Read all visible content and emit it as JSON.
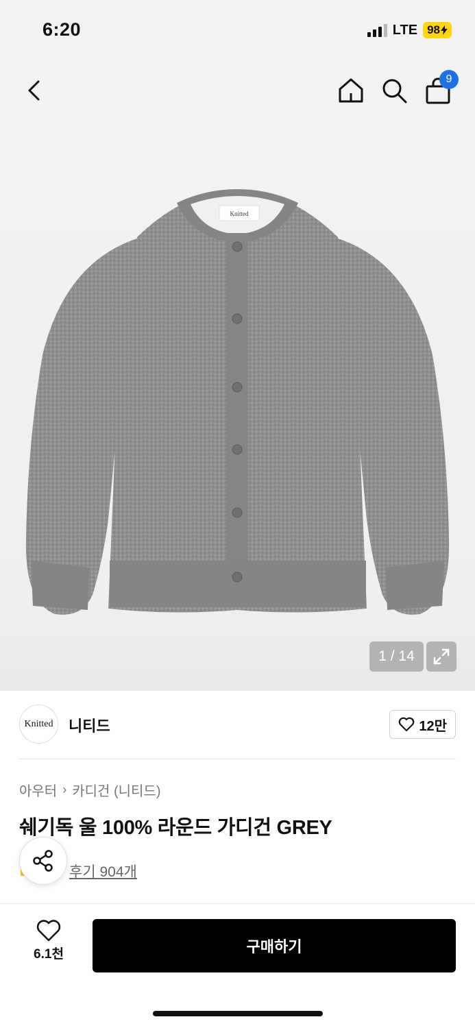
{
  "status_bar": {
    "time": "6:20",
    "network": "LTE",
    "battery": "98"
  },
  "nav": {
    "back_icon": "chevron-left-icon",
    "home_icon": "home-icon",
    "search_icon": "search-icon",
    "cart_icon": "shopping-bag-icon",
    "cart_count": "9",
    "badge_color": "#1e72e8"
  },
  "gallery": {
    "image_label_text": "Knitted",
    "counter": "1 / 14",
    "expand_icon": "expand-icon"
  },
  "brand": {
    "logo_text": "Knitted",
    "name": "니티드",
    "likes": "12만"
  },
  "product": {
    "breadcrumb": [
      "아우터",
      "카디건 (니티드)"
    ],
    "title": "쉐기독 울 100% 라운드 가디건 GREY",
    "review_link": "후기 904개",
    "share_icon": "share-icon"
  },
  "bottom_bar": {
    "wish_count": "6.1천",
    "buy_label": "구매하기",
    "buy_color": "#000000"
  }
}
